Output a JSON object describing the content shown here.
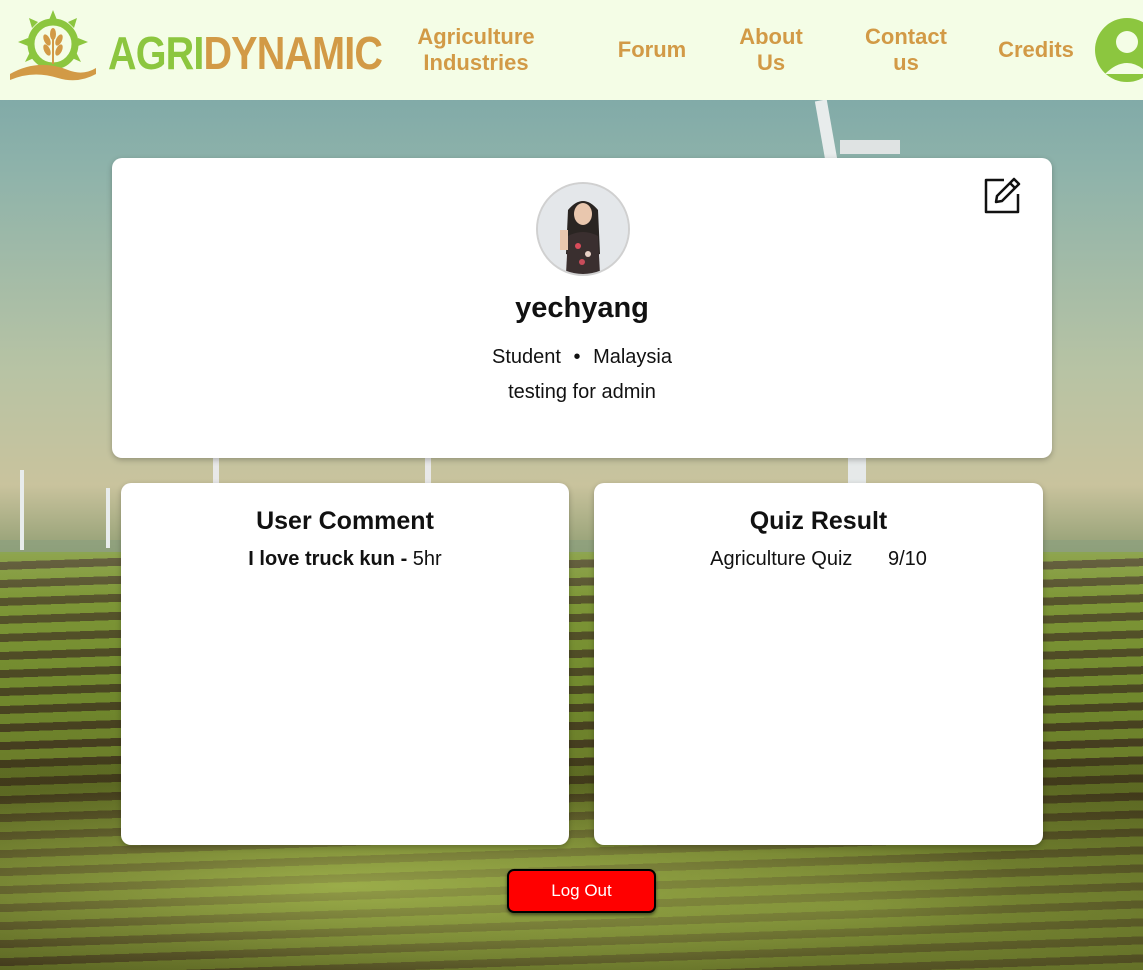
{
  "header": {
    "logo": {
      "part1": "AGRI",
      "part2": "DYNAMIC"
    },
    "nav": [
      {
        "label": "Agriculture Industries"
      },
      {
        "label": "Forum"
      },
      {
        "label": "About Us"
      },
      {
        "label": "Contact us"
      },
      {
        "label": "Credits"
      }
    ],
    "user_icon": "user-avatar-icon"
  },
  "profile": {
    "username": "yechyang",
    "role": "Student",
    "separator": "•",
    "country": "Malaysia",
    "bio": "testing for admin",
    "edit_icon": "edit-icon"
  },
  "comments": {
    "title": "User Comment",
    "items": [
      {
        "text": "I love truck kun",
        "dash": "-",
        "time": "5hr"
      }
    ]
  },
  "quiz": {
    "title": "Quiz Result",
    "items": [
      {
        "name": "Agriculture Quiz",
        "score": "9/10"
      }
    ]
  },
  "logout_label": "Log Out",
  "colors": {
    "brand_green": "#8cc63f",
    "brand_gold": "#d29a46",
    "header_bg": "#f4fde6",
    "logout_red": "#ff0000"
  }
}
